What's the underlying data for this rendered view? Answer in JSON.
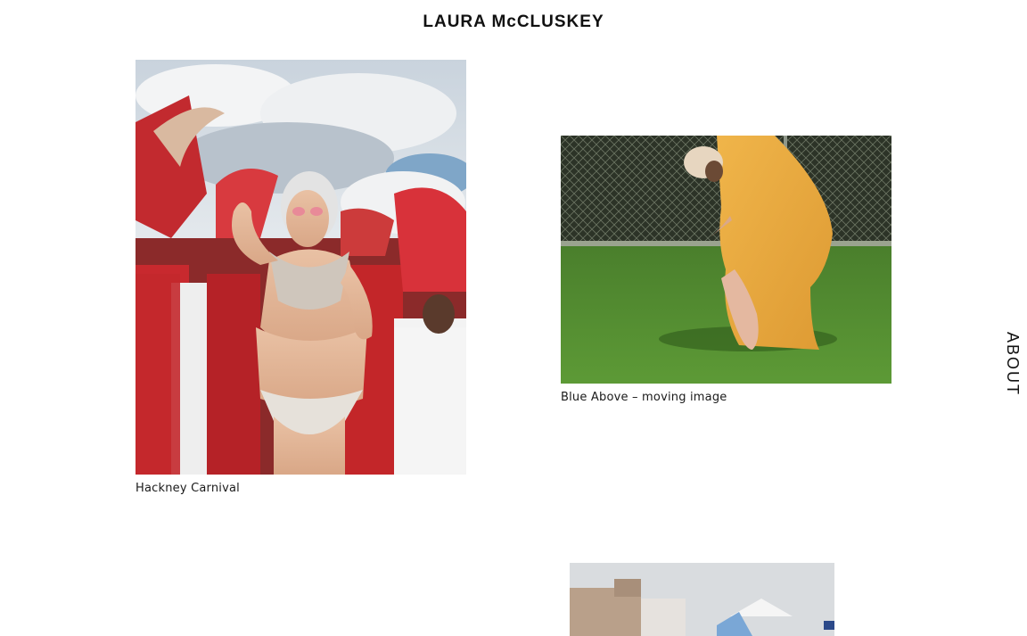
{
  "header": {
    "site_title": "LAURA McCLUSKEY"
  },
  "nav": {
    "about_label": "ABOUT"
  },
  "works": [
    {
      "caption": "Hackney Carnival"
    },
    {
      "caption": "Blue Above – moving image"
    },
    {
      "caption": ""
    }
  ],
  "colors": {
    "background": "#ffffff",
    "text": "#111111"
  }
}
